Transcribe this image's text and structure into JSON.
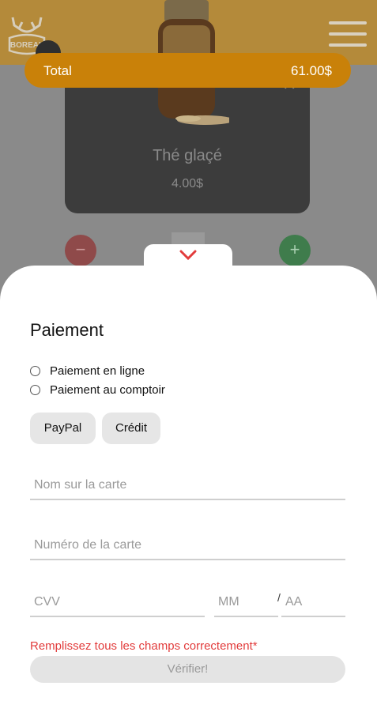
{
  "product": {
    "name": "Thé glaçé",
    "price": "4.00$"
  },
  "logo": {
    "text": "BOREAL"
  },
  "total": {
    "label": "Total",
    "value": "61.00$"
  },
  "controls": {
    "minus": "−",
    "plus": "+",
    "close": "✕"
  },
  "payment": {
    "title": "Paiement",
    "options": [
      {
        "label": "Paiement en ligne"
      },
      {
        "label": "Paiement au comptoir"
      }
    ],
    "methods": [
      {
        "label": "PayPal"
      },
      {
        "label": "Crédit"
      }
    ],
    "fields": {
      "card_name": {
        "placeholder": "Nom sur la carte"
      },
      "card_number": {
        "placeholder": "Numéro de la carte"
      },
      "cvv": {
        "placeholder": "CVV"
      },
      "month": {
        "placeholder": "MM"
      },
      "year": {
        "placeholder": "AA"
      },
      "separator": "/"
    },
    "error": "Remplissez tous les champs correctement*",
    "verify_label": "Vérifier!"
  },
  "colors": {
    "accent": "#c98109",
    "error": "#e23c3c",
    "sheet": "#ffffff"
  }
}
